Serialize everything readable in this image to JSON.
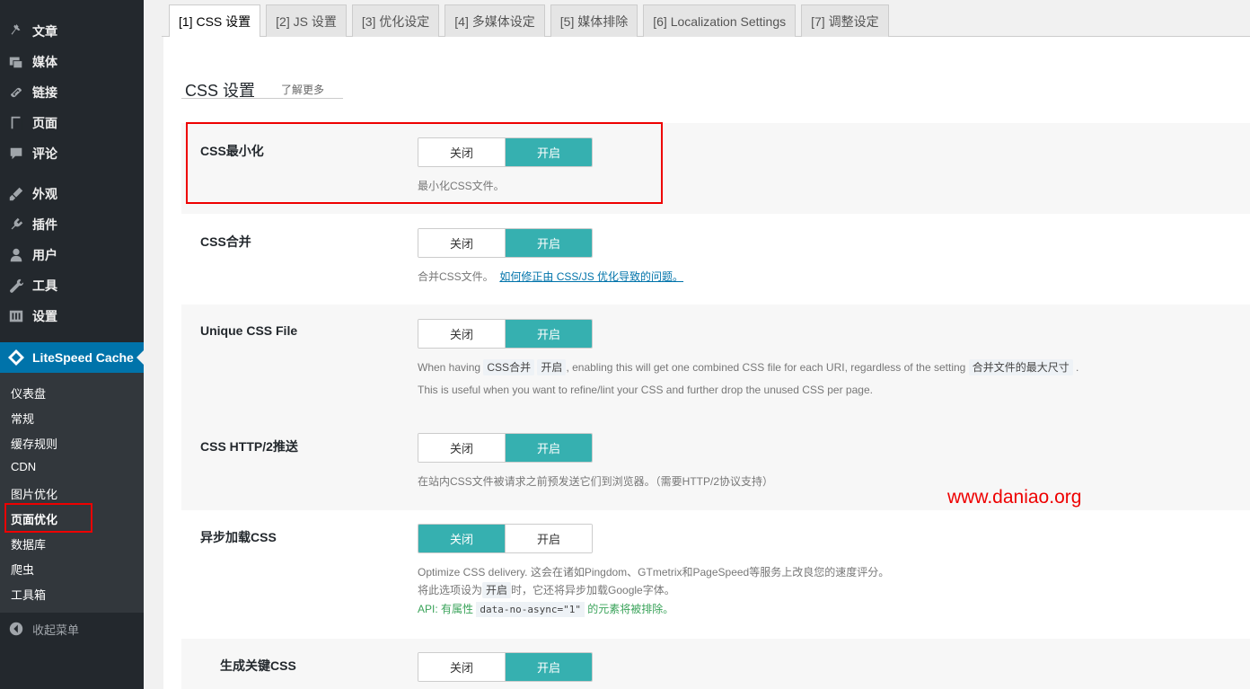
{
  "sidebar": {
    "items": [
      {
        "label": "文章",
        "icon": "pin-icon"
      },
      {
        "label": "媒体",
        "icon": "media-icon"
      },
      {
        "label": "链接",
        "icon": "link-icon"
      },
      {
        "label": "页面",
        "icon": "page-icon"
      },
      {
        "label": "评论",
        "icon": "comment-icon"
      },
      {
        "label": "外观",
        "icon": "appearance-icon"
      },
      {
        "label": "插件",
        "icon": "plugin-icon"
      },
      {
        "label": "用户",
        "icon": "user-icon"
      },
      {
        "label": "工具",
        "icon": "wrench-icon"
      },
      {
        "label": "设置",
        "icon": "settings-icon"
      }
    ],
    "active_plugin": "LiteSpeed Cache",
    "submenu": [
      "仪表盘",
      "常规",
      "缓存规则",
      "CDN",
      "图片优化",
      "页面优化",
      "数据库",
      "爬虫",
      "工具箱"
    ],
    "current_submenu": "页面优化",
    "collapse_label": "收起菜单"
  },
  "tabs": [
    {
      "label": "[1] CSS 设置",
      "active": true
    },
    {
      "label": "[2] JS 设置"
    },
    {
      "label": "[3] 优化设定"
    },
    {
      "label": "[4] 多媒体设定"
    },
    {
      "label": "[5] 媒体排除"
    },
    {
      "label": "[6] Localization Settings"
    },
    {
      "label": "[7] 调整设定"
    }
  ],
  "section": {
    "title": "CSS 设置",
    "learn_more": "了解更多"
  },
  "toggle_labels": {
    "off": "关闭",
    "on": "开启"
  },
  "settings": [
    {
      "label": "CSS最小化",
      "state": "on",
      "desc": "最小化CSS文件。"
    },
    {
      "label": "CSS合并",
      "state": "on",
      "desc": "合并CSS文件。",
      "link": "如何修正由 CSS/JS 优化导致的问题。"
    },
    {
      "label": "Unique CSS File",
      "state": "on",
      "desc1_a": "When having",
      "desc1_code1": "CSS合并",
      "desc1_code2": "开启",
      "desc1_b": ", enabling this will get one combined CSS file for each URI, regardless of the setting",
      "desc1_code3": "合并文件的最大尺寸",
      "desc1_c": ".",
      "desc2": "This is useful when you want to refine/lint your CSS and further drop the unused CSS per page."
    },
    {
      "label": "CSS HTTP/2推送",
      "state": "on",
      "desc": "在站内CSS文件被请求之前预发送它们到浏览器。（需要HTTP/2协议支持）"
    },
    {
      "label": "异步加载CSS",
      "state": "off",
      "desc1": "Optimize CSS delivery. 这会在诸如Pingdom、GTmetrix和PageSpeed等服务上改良您的速度评分。",
      "desc2_a": "将此选项设为",
      "desc2_code": "开启",
      "desc2_b": "时，它还将异步加载Google字体。",
      "api_a": "API: 有属性",
      "api_code": "data-no-async=\"1\"",
      "api_b": "的元素将被排除。"
    },
    {
      "label": "生成关键CSS",
      "state": "on"
    }
  ],
  "watermark": "www.daniao.org",
  "colors": {
    "toggle_on": "#36b0b0",
    "sidebar_bg": "#23282d",
    "active_plugin_bg": "#0073aa",
    "highlight": "#e00000"
  }
}
